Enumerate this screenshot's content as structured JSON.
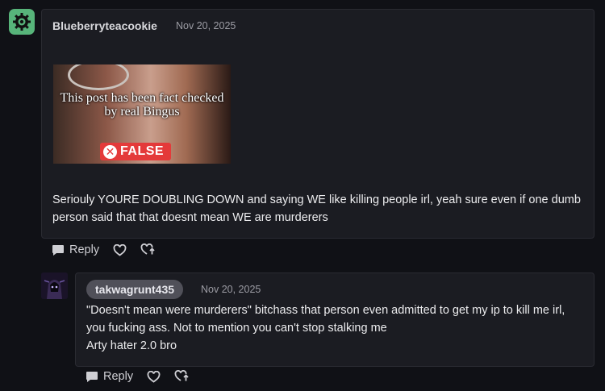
{
  "post": {
    "author": "Blueberryteacookie",
    "date": "Nov 20, 2025",
    "image": {
      "caption": "This post has been fact checked by real Bingus",
      "badge": "FALSE"
    },
    "text": "Seriouly YOURE DOUBLING DOWN and saying WE like killing people irl, yeah sure even if one dumb person said that that doesnt mean WE are murderers",
    "actions": {
      "reply_label": "Reply"
    }
  },
  "reply": {
    "author": "takwagrunt435",
    "date": "Nov 20, 2025",
    "lines": [
      "\"Doesn't mean were murderers\" bitchass that person even admitted to get my ip to kill me irl,",
      "you fucking ass. Not to mention you can't stop stalking me",
      "Arty hater 2.0 bro"
    ],
    "actions": {
      "reply_label": "Reply"
    }
  },
  "icons": [
    "gear-avatar-icon",
    "reply-bubble-icon",
    "heart-icon",
    "repost-heart-icon",
    "x-circle-icon"
  ],
  "colors": {
    "background": "#101116",
    "card": "#1b1c22",
    "avatar_green": "#57b47a",
    "false_red": "#e43a3a"
  }
}
